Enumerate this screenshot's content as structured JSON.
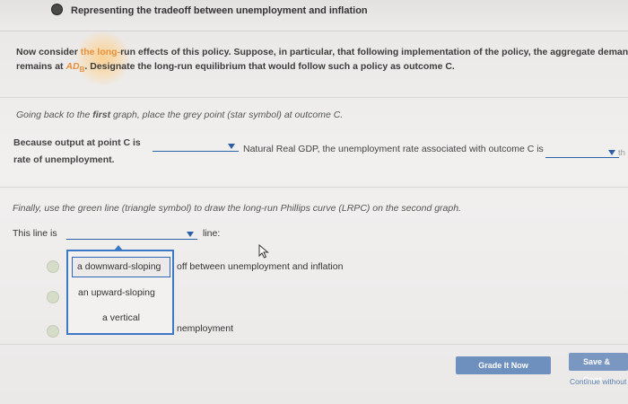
{
  "header": {
    "title": "Representing the tradeoff between unemployment and inflation"
  },
  "intro": {
    "line1_start": "Now consider ",
    "line1_highlight": "the long-",
    "line1_end": "run effects of this policy. Suppose, in particular, that following implementation of the policy, the aggregate demand curv",
    "line2_start": "remains at ",
    "line2_ad": "AD",
    "line2_sub": "B",
    "line2_end": ". Designate the long-run equilibrium that would follow such a policy as outcome C."
  },
  "question1": {
    "prompt_start": "Going back to the ",
    "prompt_bold": "first",
    "prompt_end": " graph, place the grey point (star symbol) at outcome C."
  },
  "question2": {
    "prefix": "Because output at point C is",
    "middle": "Natural Real GDP, the unemployment rate associated with outcome C is",
    "suffix_cut": "th",
    "line2": "rate of unemployment."
  },
  "question3": {
    "prompt": "Finally, use the green line (triangle symbol) to draw the long-run Phillips curve (LRPC) on the second graph.",
    "line_prefix": "This line is",
    "line_suffix": "line:"
  },
  "dropdown": {
    "options": [
      "a downward-sloping",
      "an upward-sloping",
      "a vertical"
    ]
  },
  "radio_texts": {
    "opt1_tail": "off between unemployment and inflation",
    "opt3_tail": "nemployment"
  },
  "buttons": {
    "grade": "Grade It Now",
    "save": "Save & Cont",
    "continue": "Continue without"
  }
}
